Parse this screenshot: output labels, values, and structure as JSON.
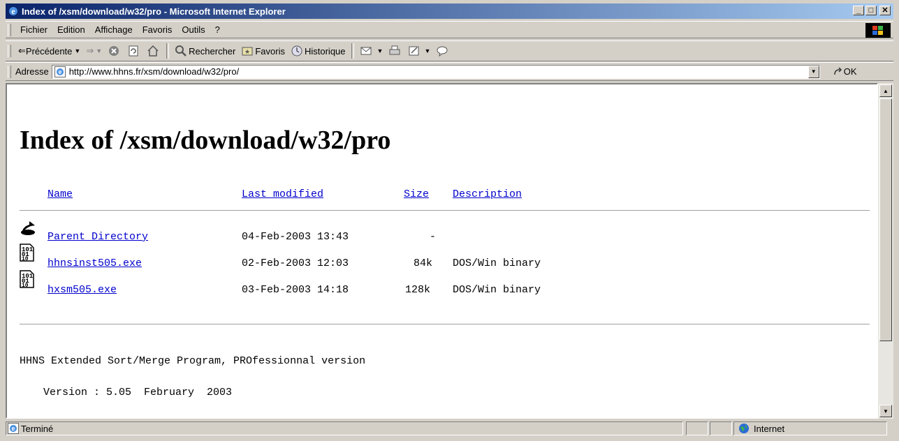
{
  "window": {
    "title": "Index of /xsm/download/w32/pro - Microsoft Internet Explorer"
  },
  "menu": [
    "Fichier",
    "Edition",
    "Affichage",
    "Favoris",
    "Outils",
    "?"
  ],
  "toolbar": {
    "back": "Précédente",
    "search": "Rechercher",
    "favorites": "Favoris",
    "history": "Historique"
  },
  "address": {
    "label": "Adresse",
    "url": "http://www.hhns.fr/xsm/download/w32/pro/",
    "go": "OK"
  },
  "page": {
    "heading": "Index of /xsm/download/w32/pro",
    "columns": {
      "name": "Name",
      "modified": "Last modified",
      "size": "Size",
      "description": "Description"
    },
    "rows": [
      {
        "name": "Parent Directory",
        "modified": "04-Feb-2003 13:43",
        "size": "-",
        "description": "",
        "icon": "back-icon"
      },
      {
        "name": "hhnsinst505.exe",
        "modified": "02-Feb-2003 12:03",
        "size": "84k",
        "description": "DOS/Win binary",
        "icon": "binary-file-icon"
      },
      {
        "name": "hxsm505.exe",
        "modified": "03-Feb-2003 14:18",
        "size": "128k",
        "description": "DOS/Win binary",
        "icon": "binary-file-icon"
      }
    ],
    "footer_line1": "HHNS Extended Sort/Merge Program, PROfessionnal version",
    "footer_line2": "Version : 5.05  February  2003"
  },
  "status": {
    "text": "Terminé",
    "zone": "Internet"
  },
  "colors": {
    "link": "#0000cc",
    "title_start": "#0a246a",
    "title_end": "#a6caf0"
  }
}
